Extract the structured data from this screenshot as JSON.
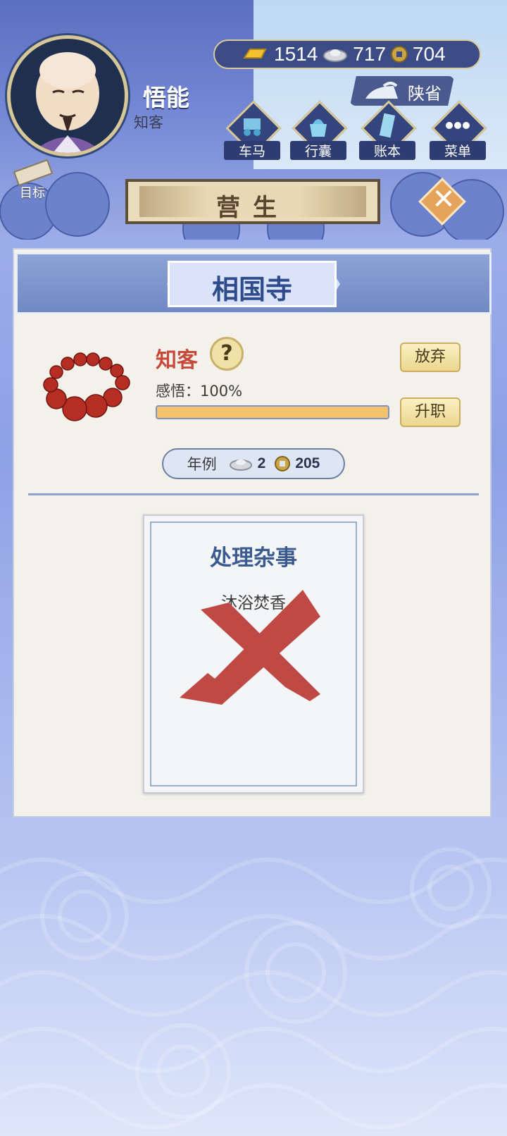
{
  "header": {
    "name": "悟能",
    "rank": "知客",
    "currency": {
      "gold": "1514",
      "silver": "717",
      "coin": "704"
    },
    "location": "陕省",
    "nav": [
      {
        "label": "车马",
        "icon": "carriage-icon"
      },
      {
        "label": "行囊",
        "icon": "bag-icon"
      },
      {
        "label": "账本",
        "icon": "ledger-icon"
      },
      {
        "label": "菜单",
        "icon": "menu-dots-icon"
      }
    ],
    "goal_label": "目标",
    "banner_title": "营生"
  },
  "panel": {
    "temple_name": "相国寺",
    "job": {
      "title": "知客",
      "help": "?",
      "insight_label": "感悟：100%",
      "insight_progress": 1.0,
      "abandon_label": "放弃",
      "promote_label": "升职"
    },
    "salary": {
      "label": "年例",
      "silver": "2",
      "coin": "205"
    },
    "task": {
      "title": "处理杂事",
      "lines": [
        "沐浴焚香"
      ],
      "status": "rejected"
    }
  },
  "colors": {
    "accent": "#2e4b8a",
    "job_title": "#c64a3c",
    "progress_fill": "#f4c26a",
    "reject_mark": "#bf4a45"
  }
}
